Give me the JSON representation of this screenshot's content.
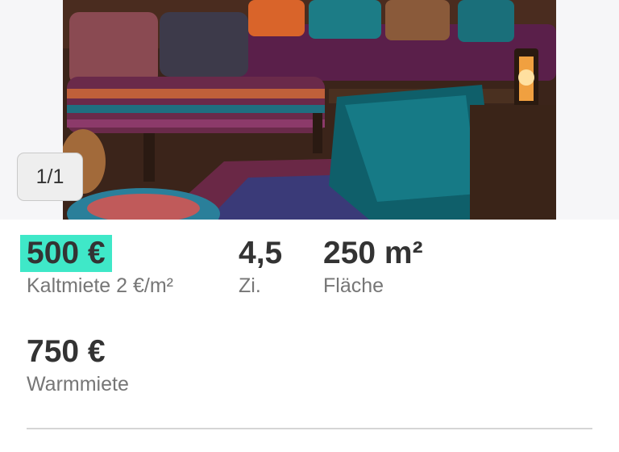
{
  "gallery": {
    "counter": "1/1",
    "image_icon": "living-room-photo"
  },
  "facts": {
    "kaltmiete": {
      "value": "500 €",
      "label": "Kaltmiete 2 €/m²"
    },
    "zimmer": {
      "value": "4,5",
      "label": "Zi."
    },
    "flaeche": {
      "value": "250 m²",
      "label": "Fläche"
    },
    "warmmiete": {
      "value": "750 €",
      "label": "Warmmiete"
    }
  },
  "colors": {
    "highlight": "#3fe8c8",
    "text": "#333333",
    "muted": "#767676"
  }
}
